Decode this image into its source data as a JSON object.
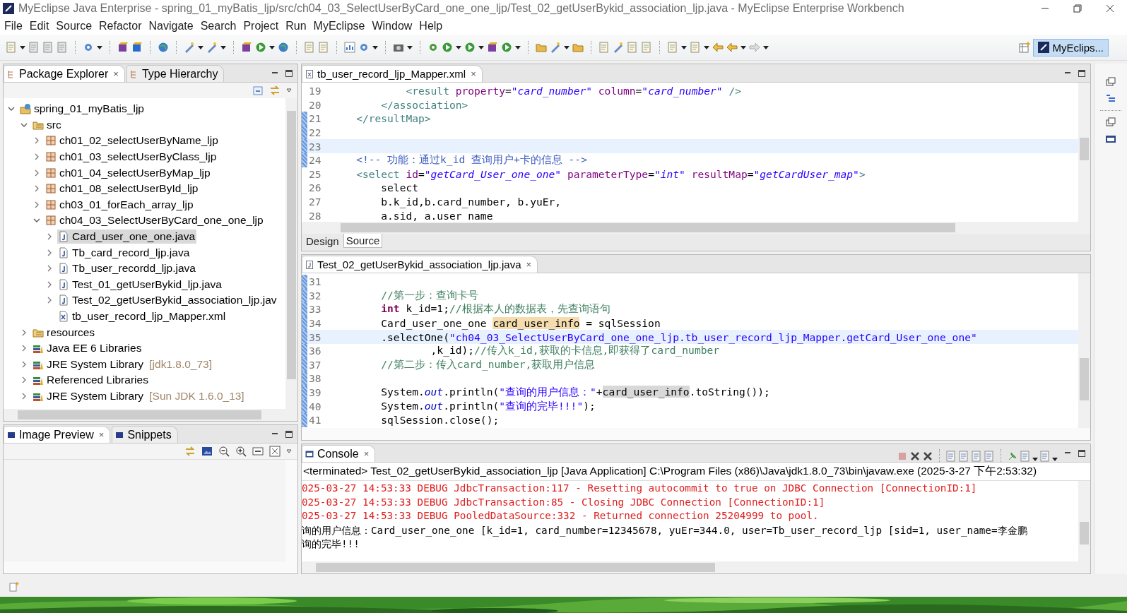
{
  "window": {
    "title": "MyEclipse Java Enterprise - spring_01_myBatis_ljp/src/ch04_03_SelectUserByCard_one_one_ljp/Test_02_getUserBykid_association_ljp.java - MyEclipse Enterprise Workbench"
  },
  "menu": [
    "File",
    "Edit",
    "Source",
    "Refactor",
    "Navigate",
    "Search",
    "Project",
    "Run",
    "MyEclipse",
    "Window",
    "Help"
  ],
  "perspective": {
    "label": "MyEclips...",
    "selected": true
  },
  "explorer": {
    "tabs": [
      {
        "label": "Package Explorer",
        "close": "×",
        "selected": true
      },
      {
        "label": "Type Hierarchy",
        "selected": false
      }
    ],
    "tree": [
      {
        "label": "spring_01_myBatis_ljp",
        "kind": "project",
        "expanded": true,
        "selected": false,
        "children": [
          {
            "label": "src",
            "kind": "source-folder",
            "expanded": true,
            "selected": false,
            "children": [
              {
                "label": "ch01_02_selectUserByName_ljp",
                "kind": "package",
                "expanded": false,
                "selected": false
              },
              {
                "label": "ch01_03_selectUserByClass_ljp",
                "kind": "package",
                "expanded": false,
                "selected": false
              },
              {
                "label": "ch01_04_selectUserByMap_ljp",
                "kind": "package",
                "expanded": false,
                "selected": false
              },
              {
                "label": "ch01_08_selectUserById_ljp",
                "kind": "package",
                "expanded": false,
                "selected": false
              },
              {
                "label": "ch03_01_forEach_array_ljp",
                "kind": "package",
                "expanded": false,
                "selected": false
              },
              {
                "label": "ch04_03_SelectUserByCard_one_one_ljp",
                "kind": "package",
                "expanded": true,
                "selected": false,
                "children": [
                  {
                    "label": "Card_user_one_one.java",
                    "kind": "java",
                    "expanded": false,
                    "selected": true
                  },
                  {
                    "label": "Tb_card_record_ljp.java",
                    "kind": "java",
                    "expanded": false,
                    "selected": false
                  },
                  {
                    "label": "Tb_user_recordd_ljp.java",
                    "kind": "java",
                    "expanded": false,
                    "selected": false
                  },
                  {
                    "label": "Test_01_getUserBykid_ljp.java",
                    "kind": "java",
                    "expanded": false,
                    "selected": false
                  },
                  {
                    "label": "Test_02_getUserBykid_association_ljp.jav",
                    "kind": "java",
                    "expanded": false,
                    "selected": false
                  },
                  {
                    "label": "tb_user_record_ljp_Mapper.xml",
                    "kind": "xml",
                    "selected": false
                  }
                ]
              }
            ]
          },
          {
            "label": "resources",
            "kind": "folder",
            "expanded": false,
            "selected": false
          },
          {
            "label": "Java EE 6 Libraries",
            "kind": "library",
            "expanded": false,
            "selected": false
          },
          {
            "label": "JRE System Library",
            "suffix": "[jdk1.8.0_73]",
            "kind": "library",
            "expanded": false,
            "selected": false
          },
          {
            "label": "Referenced Libraries",
            "kind": "library",
            "expanded": false,
            "selected": false
          },
          {
            "label": "JRE System Library",
            "suffix": "[Sun JDK 1.6.0_13]",
            "kind": "library",
            "expanded": false,
            "selected": false
          }
        ]
      }
    ]
  },
  "preview": {
    "tabs": [
      {
        "label": "Image Preview",
        "close": "×",
        "selected": true
      },
      {
        "label": "Snippets",
        "selected": false
      }
    ]
  },
  "xml_editor": {
    "tab": "tb_user_record_ljp_Mapper.xml",
    "close": "×",
    "bottom_tabs": [
      {
        "label": "Design",
        "selected": false
      },
      {
        "label": "Source",
        "selected": true
      }
    ],
    "lines": [
      {
        "n": "19",
        "changed": false,
        "current": false,
        "tokens": [
          {
            "t": "            <result",
            "kind": "tag"
          },
          {
            "t": " property",
            "kind": "attr"
          },
          {
            "t": "=",
            "kind": "plain"
          },
          {
            "t": "\"card_number\"",
            "kind": "value"
          },
          {
            "t": " column",
            "kind": "attr"
          },
          {
            "t": "=",
            "kind": "plain"
          },
          {
            "t": "\"card_number\"",
            "kind": "value"
          },
          {
            "t": " />",
            "kind": "tag"
          }
        ]
      },
      {
        "n": "20",
        "changed": false,
        "current": false,
        "tokens": [
          {
            "t": "        </association>",
            "kind": "tag"
          }
        ]
      },
      {
        "n": "21",
        "changed": true,
        "current": false,
        "tokens": [
          {
            "t": "    </resultMap>",
            "kind": "tag"
          }
        ]
      },
      {
        "n": "22",
        "changed": true,
        "current": false
      },
      {
        "n": "23",
        "changed": true,
        "current": true
      },
      {
        "n": "24",
        "changed": true,
        "current": false,
        "tokens": [
          {
            "t": "    <!-- 功能：通过k_id 查询用户+卡的信息 -->",
            "kind": "xcomment"
          }
        ]
      },
      {
        "n": "25",
        "changed": false,
        "current": false,
        "tokens": [
          {
            "t": "    <select",
            "kind": "tag"
          },
          {
            "t": " id",
            "kind": "attr"
          },
          {
            "t": "=",
            "kind": "plain"
          },
          {
            "t": "\"getCard_User_one_one\"",
            "kind": "value"
          },
          {
            "t": " parameterType",
            "kind": "attr"
          },
          {
            "t": "=",
            "kind": "plain"
          },
          {
            "t": "\"int\"",
            "kind": "value"
          },
          {
            "t": " resultMap",
            "kind": "attr"
          },
          {
            "t": "=",
            "kind": "plain"
          },
          {
            "t": "\"getCardUser_map\"",
            "kind": "value"
          },
          {
            "t": ">",
            "kind": "tag"
          }
        ]
      },
      {
        "n": "26",
        "changed": false,
        "current": false,
        "tokens": [
          {
            "t": "        select",
            "kind": "plain"
          }
        ]
      },
      {
        "n": "27",
        "changed": false,
        "current": false,
        "tokens": [
          {
            "t": "        b.k_id,b.card_number, b.yuEr,",
            "kind": "plain"
          }
        ]
      },
      {
        "n": "28",
        "changed": false,
        "current": false,
        "tokens": [
          {
            "t": "        a.sid, a.user_name",
            "kind": "plain"
          }
        ]
      }
    ]
  },
  "java_editor": {
    "tab": "Test_02_getUserBykid_association_ljp.java",
    "close": "×",
    "lines": [
      {
        "n": "31",
        "changed": true,
        "current": false
      },
      {
        "n": "32",
        "changed": true,
        "current": false,
        "tokens": [
          {
            "t": "        //第一步：查询卡号",
            "kind": "comment"
          }
        ]
      },
      {
        "n": "33",
        "changed": true,
        "current": false,
        "tokens": [
          {
            "t": "        int",
            "kind": "keyword"
          },
          {
            "t": " k_id=1;",
            "kind": "plain"
          },
          {
            "t": "//根据本人的数据表，先查询语句",
            "kind": "comment"
          }
        ]
      },
      {
        "n": "34",
        "changed": true,
        "current": false,
        "tokens": [
          {
            "t": "        Card_user_one_one ",
            "kind": "plain"
          },
          {
            "t": "card_user_info",
            "kind": "write-mark"
          },
          {
            "t": " = sqlSession",
            "kind": "plain"
          }
        ]
      },
      {
        "n": "35",
        "changed": true,
        "current": true,
        "tokens": [
          {
            "t": "        .selectOne(",
            "kind": "plain"
          },
          {
            "t": "\"ch04_03_SelectUserByCard_one_one_ljp.tb_user_record_ljp_Mapper.getCard_User_one_one\"",
            "kind": "string"
          }
        ]
      },
      {
        "n": "36",
        "changed": true,
        "current": false,
        "tokens": [
          {
            "t": "                ,k_id);",
            "kind": "plain"
          },
          {
            "t": "//传入k_id,获取的卡信息,即获得了card_number",
            "kind": "comment"
          }
        ]
      },
      {
        "n": "37",
        "changed": true,
        "current": false,
        "tokens": [
          {
            "t": "        //第二步：传入card_number,获取用户信息",
            "kind": "comment"
          }
        ]
      },
      {
        "n": "38",
        "changed": true,
        "current": false
      },
      {
        "n": "39",
        "changed": true,
        "current": false,
        "tokens": [
          {
            "t": "        System.",
            "kind": "plain"
          },
          {
            "t": "out",
            "kind": "field"
          },
          {
            "t": ".println(",
            "kind": "plain"
          },
          {
            "t": "\"查询的用户信息：\"",
            "kind": "string"
          },
          {
            "t": "+",
            "kind": "plain"
          },
          {
            "t": "card_user_info",
            "kind": "read-mark"
          },
          {
            "t": ".toString());",
            "kind": "plain"
          }
        ]
      },
      {
        "n": "40",
        "changed": true,
        "current": false,
        "tokens": [
          {
            "t": "        System.",
            "kind": "plain"
          },
          {
            "t": "out",
            "kind": "field"
          },
          {
            "t": ".println(",
            "kind": "plain"
          },
          {
            "t": "\"查询的完毕!!!\"",
            "kind": "string"
          },
          {
            "t": ");",
            "kind": "plain"
          }
        ]
      },
      {
        "n": "41",
        "changed": true,
        "current": false,
        "tokens": [
          {
            "t": "        sqlSession.close();",
            "kind": "plain"
          }
        ]
      }
    ]
  },
  "console": {
    "tab": "Console",
    "close": "×",
    "header": "<terminated> Test_02_getUserBykid_association_ljp [Java Application] C:\\Program Files (x86)\\Java\\jdk1.8.0_73\\bin\\javaw.exe (2025-3-27 下午2:53:32)",
    "lines": [
      {
        "kind": "error",
        "text": "025-03-27 14:53:33 DEBUG JdbcTransaction:117 - Resetting autocommit to true on JDBC Connection [ConnectionID:1]"
      },
      {
        "kind": "error",
        "text": "025-03-27 14:53:33 DEBUG JdbcTransaction:85 - Closing JDBC Connection [ConnectionID:1]"
      },
      {
        "kind": "error",
        "text": "025-03-27 14:53:33 DEBUG PooledDataSource:332 - Returned connection 25204999 to pool."
      },
      {
        "kind": "output",
        "text": "询的用户信息：Card_user_one_one [k_id=1, card_number=12345678, yuEr=344.0, user=Tb_user_record_ljp [sid=1, user_name=李金鹏"
      },
      {
        "kind": "output",
        "text": "询的完毕!!!"
      }
    ]
  }
}
